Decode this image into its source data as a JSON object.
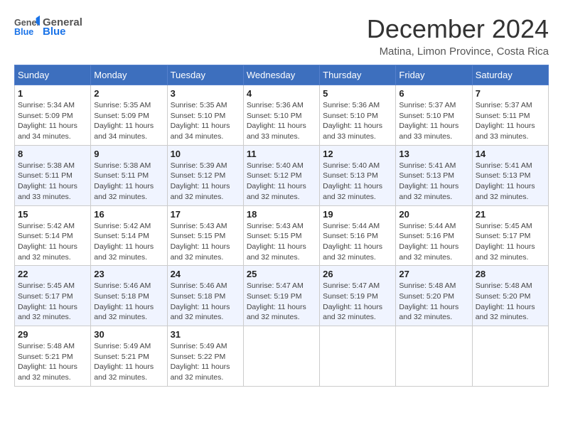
{
  "logo": {
    "general": "General",
    "blue": "Blue"
  },
  "header": {
    "month": "December 2024",
    "location": "Matina, Limon Province, Costa Rica"
  },
  "days_of_week": [
    "Sunday",
    "Monday",
    "Tuesday",
    "Wednesday",
    "Thursday",
    "Friday",
    "Saturday"
  ],
  "weeks": [
    [
      {
        "day": 1,
        "sunrise": "5:34 AM",
        "sunset": "5:09 PM",
        "daylight": "11 hours and 34 minutes."
      },
      {
        "day": 2,
        "sunrise": "5:35 AM",
        "sunset": "5:09 PM",
        "daylight": "11 hours and 34 minutes."
      },
      {
        "day": 3,
        "sunrise": "5:35 AM",
        "sunset": "5:10 PM",
        "daylight": "11 hours and 34 minutes."
      },
      {
        "day": 4,
        "sunrise": "5:36 AM",
        "sunset": "5:10 PM",
        "daylight": "11 hours and 33 minutes."
      },
      {
        "day": 5,
        "sunrise": "5:36 AM",
        "sunset": "5:10 PM",
        "daylight": "11 hours and 33 minutes."
      },
      {
        "day": 6,
        "sunrise": "5:37 AM",
        "sunset": "5:10 PM",
        "daylight": "11 hours and 33 minutes."
      },
      {
        "day": 7,
        "sunrise": "5:37 AM",
        "sunset": "5:11 PM",
        "daylight": "11 hours and 33 minutes."
      }
    ],
    [
      {
        "day": 8,
        "sunrise": "5:38 AM",
        "sunset": "5:11 PM",
        "daylight": "11 hours and 33 minutes."
      },
      {
        "day": 9,
        "sunrise": "5:38 AM",
        "sunset": "5:11 PM",
        "daylight": "11 hours and 32 minutes."
      },
      {
        "day": 10,
        "sunrise": "5:39 AM",
        "sunset": "5:12 PM",
        "daylight": "11 hours and 32 minutes."
      },
      {
        "day": 11,
        "sunrise": "5:40 AM",
        "sunset": "5:12 PM",
        "daylight": "11 hours and 32 minutes."
      },
      {
        "day": 12,
        "sunrise": "5:40 AM",
        "sunset": "5:13 PM",
        "daylight": "11 hours and 32 minutes."
      },
      {
        "day": 13,
        "sunrise": "5:41 AM",
        "sunset": "5:13 PM",
        "daylight": "11 hours and 32 minutes."
      },
      {
        "day": 14,
        "sunrise": "5:41 AM",
        "sunset": "5:13 PM",
        "daylight": "11 hours and 32 minutes."
      }
    ],
    [
      {
        "day": 15,
        "sunrise": "5:42 AM",
        "sunset": "5:14 PM",
        "daylight": "11 hours and 32 minutes."
      },
      {
        "day": 16,
        "sunrise": "5:42 AM",
        "sunset": "5:14 PM",
        "daylight": "11 hours and 32 minutes."
      },
      {
        "day": 17,
        "sunrise": "5:43 AM",
        "sunset": "5:15 PM",
        "daylight": "11 hours and 32 minutes."
      },
      {
        "day": 18,
        "sunrise": "5:43 AM",
        "sunset": "5:15 PM",
        "daylight": "11 hours and 32 minutes."
      },
      {
        "day": 19,
        "sunrise": "5:44 AM",
        "sunset": "5:16 PM",
        "daylight": "11 hours and 32 minutes."
      },
      {
        "day": 20,
        "sunrise": "5:44 AM",
        "sunset": "5:16 PM",
        "daylight": "11 hours and 32 minutes."
      },
      {
        "day": 21,
        "sunrise": "5:45 AM",
        "sunset": "5:17 PM",
        "daylight": "11 hours and 32 minutes."
      }
    ],
    [
      {
        "day": 22,
        "sunrise": "5:45 AM",
        "sunset": "5:17 PM",
        "daylight": "11 hours and 32 minutes."
      },
      {
        "day": 23,
        "sunrise": "5:46 AM",
        "sunset": "5:18 PM",
        "daylight": "11 hours and 32 minutes."
      },
      {
        "day": 24,
        "sunrise": "5:46 AM",
        "sunset": "5:18 PM",
        "daylight": "11 hours and 32 minutes."
      },
      {
        "day": 25,
        "sunrise": "5:47 AM",
        "sunset": "5:19 PM",
        "daylight": "11 hours and 32 minutes."
      },
      {
        "day": 26,
        "sunrise": "5:47 AM",
        "sunset": "5:19 PM",
        "daylight": "11 hours and 32 minutes."
      },
      {
        "day": 27,
        "sunrise": "5:48 AM",
        "sunset": "5:20 PM",
        "daylight": "11 hours and 32 minutes."
      },
      {
        "day": 28,
        "sunrise": "5:48 AM",
        "sunset": "5:20 PM",
        "daylight": "11 hours and 32 minutes."
      }
    ],
    [
      {
        "day": 29,
        "sunrise": "5:48 AM",
        "sunset": "5:21 PM",
        "daylight": "11 hours and 32 minutes."
      },
      {
        "day": 30,
        "sunrise": "5:49 AM",
        "sunset": "5:21 PM",
        "daylight": "11 hours and 32 minutes."
      },
      {
        "day": 31,
        "sunrise": "5:49 AM",
        "sunset": "5:22 PM",
        "daylight": "11 hours and 32 minutes."
      },
      null,
      null,
      null,
      null
    ]
  ]
}
